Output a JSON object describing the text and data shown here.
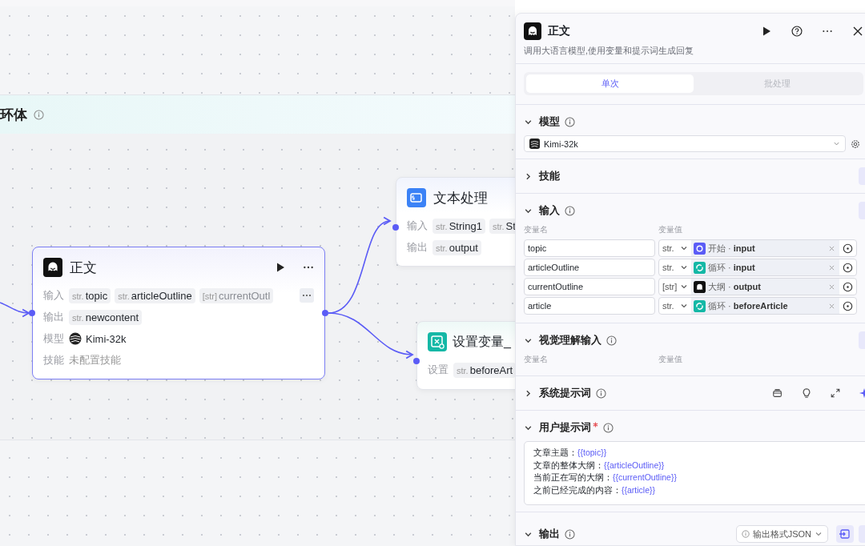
{
  "canvas": {
    "loop": {
      "title": "环体"
    },
    "main_node": {
      "title": "正文",
      "selected": true,
      "inputs_label": "输入",
      "inputs": [
        {
          "type": "str.",
          "name": "topic",
          "faded": false
        },
        {
          "type": "str.",
          "name": "articleOutline",
          "faded": false
        },
        {
          "type": "[str]",
          "name": "currentOutl",
          "faded": true
        }
      ],
      "outputs_label": "输出",
      "outputs": [
        {
          "type": "str.",
          "name": "newcontent",
          "faded": false
        }
      ],
      "model_label": "模型",
      "model": "Kimi-32k",
      "skills_label": "技能",
      "skills": "未配置技能"
    },
    "text_node": {
      "title": "文本处理",
      "inputs_label": "输入",
      "inputs": [
        {
          "type": "str.",
          "name": "String1"
        },
        {
          "type": "str.",
          "name": "St"
        }
      ],
      "outputs_label": "输出",
      "outputs": [
        {
          "type": "str.",
          "name": "output"
        }
      ]
    },
    "setvar_node": {
      "title": "设置变量_",
      "setting_label": "设置",
      "settings": [
        {
          "type": "str.",
          "name": "beforeArt"
        }
      ]
    }
  },
  "panel": {
    "title": "正文",
    "description": "调用大语言模型,使用变量和提示词生成回复",
    "tabs": [
      {
        "label": "单次",
        "selected": true
      },
      {
        "label": "批处理",
        "selected": false
      }
    ],
    "model_section": {
      "title": "模型",
      "expanded": true,
      "model": "Kimi-32k"
    },
    "skills_section": {
      "title": "技能",
      "expanded": false
    },
    "input_section": {
      "title": "输入",
      "expanded": true,
      "name_header": "变量名",
      "value_header": "变量值",
      "rows": [
        {
          "name": "topic",
          "type": "str.",
          "kind": "start",
          "source": "开始 ·",
          "field": "input"
        },
        {
          "name": "articleOutline",
          "type": "str.",
          "kind": "loop",
          "source": "循环 ·",
          "field": "input"
        },
        {
          "name": "currentOutline",
          "type": "[str]",
          "kind": "llm",
          "source": "大纲 ·",
          "field": "output"
        },
        {
          "name": "article",
          "type": "str.",
          "kind": "loop",
          "source": "循环 ·",
          "field": "beforeArticle"
        }
      ]
    },
    "vision_section": {
      "title": "视觉理解输入",
      "expanded": true,
      "name_header": "变量名",
      "value_header": "变量值"
    },
    "system_prompt_section": {
      "title": "系统提示词",
      "expanded": false
    },
    "user_prompt_section": {
      "title": "用户提示词",
      "expanded": true,
      "required": true,
      "lines": [
        {
          "label": "文章主题：",
          "variable": "{{topic}}"
        },
        {
          "label": "文章的整体大纲：",
          "variable": "{{articleOutline}}"
        },
        {
          "label": "当前正在写的大纲：",
          "variable": "{{currentOutline}}"
        },
        {
          "label": "之前已经完成的内容：",
          "variable": "{{article}}"
        }
      ]
    },
    "output_section": {
      "title": "输出",
      "expanded": true,
      "format": "输出格式JSON"
    }
  }
}
